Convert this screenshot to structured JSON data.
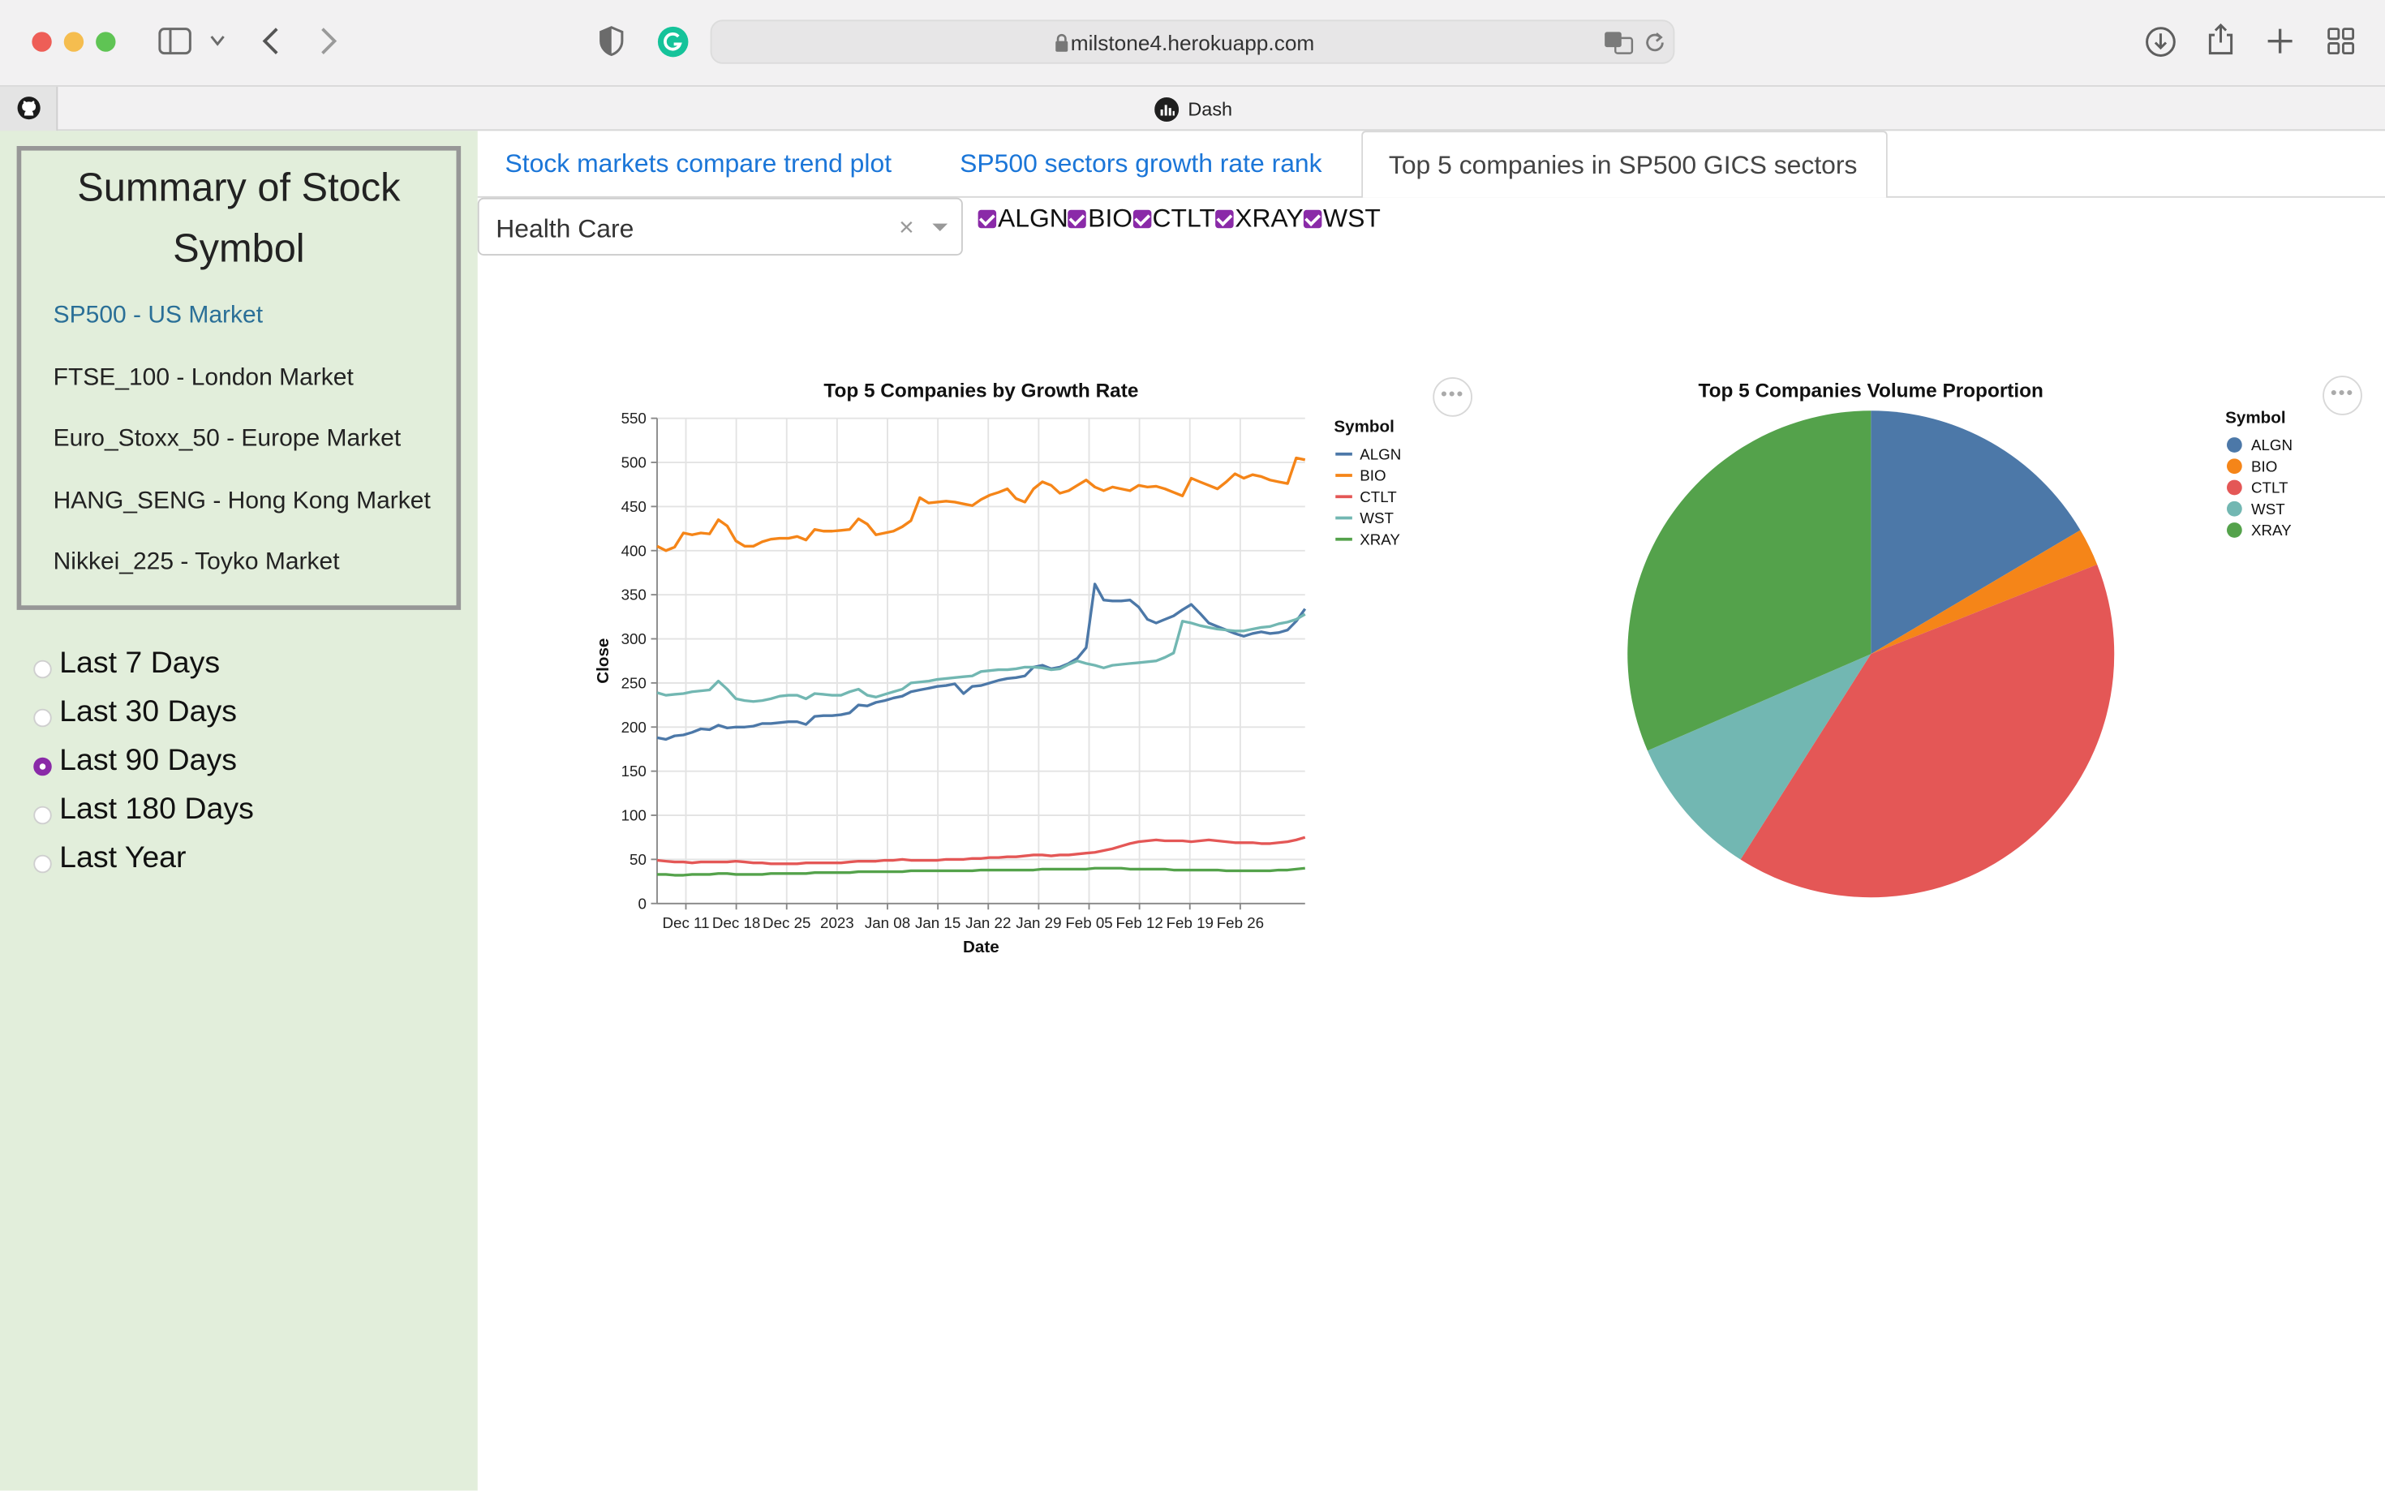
{
  "browser": {
    "url": "milstone4.herokuapp.com",
    "tab_title": "Dash"
  },
  "sidebar": {
    "summary_title": "Summary of Stock Symbol",
    "markets": [
      {
        "label": "SP500 - US Market",
        "active": true
      },
      {
        "label": "FTSE_100 - London Market",
        "active": false
      },
      {
        "label": "Euro_Stoxx_50 - Europe Market",
        "active": false
      },
      {
        "label": "HANG_SENG - Hong Kong Market",
        "active": false
      },
      {
        "label": "Nikkei_225 - Toyko Market",
        "active": false
      }
    ],
    "periods": [
      {
        "label": "Last 7 Days",
        "selected": false
      },
      {
        "label": "Last 30 Days",
        "selected": false
      },
      {
        "label": "Last 90 Days",
        "selected": true
      },
      {
        "label": "Last 180 Days",
        "selected": false
      },
      {
        "label": "Last Year",
        "selected": false
      }
    ]
  },
  "tabs": [
    {
      "label": "Stock markets compare trend plot",
      "active": false
    },
    {
      "label": "SP500 sectors growth rate rank",
      "active": false
    },
    {
      "label": "Top 5 companies in SP500 GICS sectors",
      "active": true
    }
  ],
  "sector_dropdown": {
    "value": "Health Care",
    "clear_glyph": "×"
  },
  "symbol_checklist": [
    "ALGN",
    "BIO",
    "CTLT",
    "XRAY",
    "WST"
  ],
  "colors": {
    "ALGN": "#4c78a8",
    "BIO": "#f58518",
    "CTLT": "#e45756",
    "WST": "#72b7b2",
    "XRAY": "#54a24b",
    "accent": "#8a2aa8",
    "link": "#1b76d8",
    "sidebar_bg": "#e2eedb"
  },
  "menu_glyph": "•••",
  "chart_data": [
    {
      "type": "line",
      "title": "Top 5 Companies by Growth Rate",
      "xlabel": "Date",
      "ylabel": "Close",
      "ylim": [
        0,
        550
      ],
      "yticks": [
        0,
        50,
        100,
        150,
        200,
        250,
        300,
        350,
        400,
        450,
        500,
        550
      ],
      "xtick_labels": [
        "Dec 11",
        "Dec 18",
        "Dec 25",
        "2023",
        "Jan 08",
        "Jan 15",
        "Jan 22",
        "Jan 29",
        "Feb 05",
        "Feb 12",
        "Feb 19",
        "Feb 26"
      ],
      "x_range_days": [
        0,
        90
      ],
      "xtick_days": [
        4,
        11,
        18,
        25,
        32,
        39,
        46,
        53,
        60,
        67,
        74,
        81
      ],
      "grid": true,
      "legend_title": "Symbol",
      "legend_position": "right",
      "series": [
        {
          "name": "ALGN",
          "values": [
            188,
            186,
            190,
            191,
            194,
            198,
            197,
            202,
            199,
            200,
            200,
            201,
            204,
            204,
            205,
            206,
            206,
            203,
            212,
            213,
            213,
            214,
            216,
            225,
            224,
            228,
            230,
            233,
            235,
            240,
            242,
            244,
            246,
            247,
            249,
            238,
            246,
            247,
            250,
            253,
            255,
            256,
            258,
            268,
            270,
            266,
            268,
            272,
            278,
            290,
            362,
            344,
            343,
            343,
            344,
            336,
            322,
            318,
            322,
            326,
            333,
            339,
            329,
            318,
            314,
            310,
            306,
            303,
            306,
            308,
            306,
            307,
            310,
            320,
            334
          ]
        },
        {
          "name": "BIO",
          "values": [
            405,
            400,
            404,
            420,
            418,
            420,
            419,
            435,
            428,
            411,
            405,
            405,
            410,
            413,
            414,
            414,
            416,
            412,
            424,
            422,
            422,
            423,
            424,
            436,
            430,
            418,
            420,
            422,
            427,
            434,
            460,
            454,
            455,
            456,
            455,
            453,
            451,
            458,
            463,
            466,
            470,
            459,
            455,
            470,
            478,
            474,
            465,
            468,
            474,
            480,
            472,
            468,
            472,
            470,
            468,
            474,
            472,
            473,
            470,
            466,
            462,
            482,
            478,
            474,
            470,
            478,
            487,
            482,
            486,
            484,
            480,
            478,
            476,
            505,
            503
          ]
        },
        {
          "name": "CTLT",
          "values": [
            49,
            48,
            47,
            47,
            46,
            47,
            47,
            47,
            47,
            48,
            47,
            46,
            46,
            45,
            45,
            45,
            45,
            46,
            46,
            46,
            46,
            46,
            47,
            48,
            48,
            48,
            49,
            49,
            50,
            49,
            49,
            49,
            49,
            50,
            50,
            50,
            51,
            51,
            52,
            52,
            53,
            53,
            54,
            55,
            55,
            54,
            55,
            55,
            56,
            57,
            58,
            60,
            62,
            65,
            68,
            70,
            71,
            72,
            71,
            71,
            71,
            70,
            71,
            72,
            71,
            70,
            69,
            69,
            69,
            68,
            68,
            69,
            70,
            72,
            75
          ]
        },
        {
          "name": "WST",
          "values": [
            239,
            236,
            237,
            238,
            240,
            241,
            242,
            252,
            243,
            232,
            230,
            229,
            230,
            232,
            235,
            236,
            236,
            232,
            238,
            237,
            236,
            236,
            240,
            243,
            236,
            234,
            237,
            240,
            243,
            250,
            251,
            252,
            254,
            255,
            256,
            257,
            258,
            263,
            264,
            265,
            265,
            266,
            268,
            268,
            267,
            265,
            266,
            271,
            275,
            272,
            270,
            267,
            270,
            271,
            272,
            273,
            274,
            275,
            279,
            284,
            320,
            318,
            315,
            313,
            311,
            310,
            309,
            309,
            311,
            313,
            314,
            317,
            319,
            322,
            328
          ]
        },
        {
          "name": "XRAY",
          "values": [
            33,
            33,
            32,
            32,
            33,
            33,
            33,
            34,
            34,
            33,
            33,
            33,
            33,
            34,
            34,
            34,
            34,
            34,
            35,
            35,
            35,
            35,
            35,
            36,
            36,
            36,
            36,
            36,
            36,
            37,
            37,
            37,
            37,
            37,
            37,
            37,
            37,
            38,
            38,
            38,
            38,
            38,
            38,
            38,
            39,
            39,
            39,
            39,
            39,
            39,
            40,
            40,
            40,
            40,
            39,
            39,
            39,
            39,
            39,
            38,
            38,
            38,
            38,
            38,
            38,
            37,
            37,
            37,
            37,
            37,
            37,
            38,
            38,
            39,
            40
          ]
        }
      ]
    },
    {
      "type": "pie",
      "title": "Top 5 Companies Volume Proportion",
      "legend_title": "Symbol",
      "legend_position": "right",
      "labels": [
        "ALGN",
        "BIO",
        "CTLT",
        "WST",
        "XRAY"
      ],
      "values": [
        16.5,
        2.5,
        40.0,
        9.5,
        31.5
      ]
    }
  ]
}
